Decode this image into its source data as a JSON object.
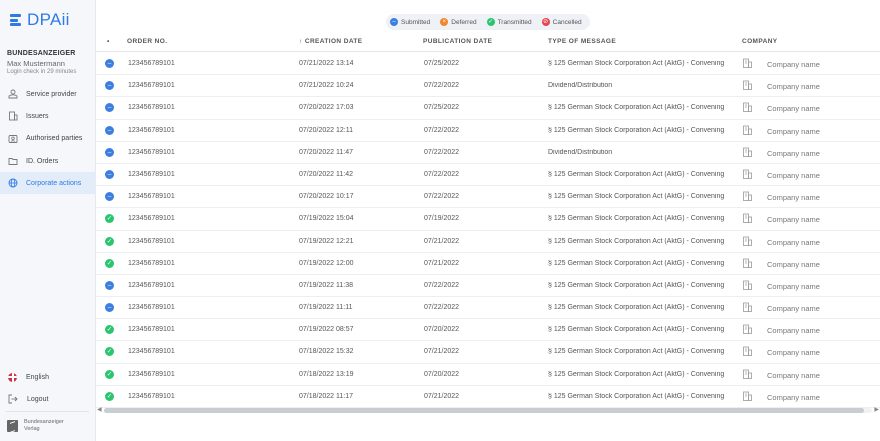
{
  "brand": {
    "logo_text": "DPAii",
    "accent": "#2d7be5"
  },
  "account": {
    "org_name": "BUNDESANZEIGER",
    "user_name": "Max Mustermann",
    "login_note": "Login check in 29 minutes"
  },
  "nav": {
    "items": [
      {
        "label": "Service provider",
        "icon": "service-icon"
      },
      {
        "label": "Issuers",
        "icon": "building-icon"
      },
      {
        "label": "Authorised parties",
        "icon": "party-icon"
      },
      {
        "label": "ID. Orders",
        "icon": "folder-icon"
      },
      {
        "label": "Corporate actions",
        "icon": "globe-icon",
        "active": true
      }
    ]
  },
  "footer": {
    "language": "English",
    "logout": "Logout",
    "brand_line1": "Bundesanzeiger",
    "brand_line2": "Verlag"
  },
  "legend": {
    "submitted": "Submitted",
    "deferred": "Deferred",
    "transmitted": "Transmitted",
    "cancelled": "Cancelled",
    "colors": {
      "submitted": "#3d7fe0",
      "deferred": "#f0872c",
      "transmitted": "#2bc56f",
      "cancelled": "#e6434f"
    }
  },
  "table": {
    "headers": {
      "sort": "•",
      "order_no": "ORDER NO.",
      "creation_date": "↑ CREATION DATE",
      "publication_date": "PUBLICATION DATE",
      "type": "TYPE OF MESSAGE",
      "company": "COMPANY"
    },
    "rows": [
      {
        "status": "submitted",
        "order_no": "123456789101",
        "created": "07/21/2022 13:14",
        "published": "07/25/2022",
        "type": "§ 125 German Stock Corporation Act (AktG) - Convening",
        "company": "Company name"
      },
      {
        "status": "submitted",
        "order_no": "123456789101",
        "created": "07/21/2022 10:24",
        "published": "07/22/2022",
        "type": "Dividend/Distribution",
        "company": "Company name"
      },
      {
        "status": "submitted",
        "order_no": "123456789101",
        "created": "07/20/2022 17:03",
        "published": "07/25/2022",
        "type": "§ 125 German Stock Corporation Act (AktG) - Convening",
        "company": "Company name"
      },
      {
        "status": "submitted",
        "order_no": "123456789101",
        "created": "07/20/2022 12:11",
        "published": "07/22/2022",
        "type": "§ 125 German Stock Corporation Act (AktG) - Convening",
        "company": "Company name"
      },
      {
        "status": "submitted",
        "order_no": "123456789101",
        "created": "07/20/2022 11:47",
        "published": "07/22/2022",
        "type": "Dividend/Distribution",
        "company": "Company name"
      },
      {
        "status": "submitted",
        "order_no": "123456789101",
        "created": "07/20/2022 11:42",
        "published": "07/22/2022",
        "type": "§ 125 German Stock Corporation Act (AktG) - Convening",
        "company": "Company name"
      },
      {
        "status": "submitted",
        "order_no": "123456789101",
        "created": "07/20/2022 10:17",
        "published": "07/22/2022",
        "type": "§ 125 German Stock Corporation Act (AktG) - Convening",
        "company": "Company name"
      },
      {
        "status": "transmitted",
        "order_no": "123456789101",
        "created": "07/19/2022 15:04",
        "published": "07/19/2022",
        "type": "§ 125 German Stock Corporation Act (AktG) - Convening",
        "company": "Company name"
      },
      {
        "status": "transmitted",
        "order_no": "123456789101",
        "created": "07/19/2022 12:21",
        "published": "07/21/2022",
        "type": "§ 125 German Stock Corporation Act (AktG) - Convening",
        "company": "Company name"
      },
      {
        "status": "transmitted",
        "order_no": "123456789101",
        "created": "07/19/2022 12:00",
        "published": "07/21/2022",
        "type": "§ 125 German Stock Corporation Act (AktG) - Convening",
        "company": "Company name"
      },
      {
        "status": "submitted",
        "order_no": "123456789101",
        "created": "07/19/2022 11:38",
        "published": "07/22/2022",
        "type": "§ 125 German Stock Corporation Act (AktG) - Convening",
        "company": "Company name"
      },
      {
        "status": "submitted",
        "order_no": "123456789101",
        "created": "07/19/2022 11:11",
        "published": "07/22/2022",
        "type": "§ 125 German Stock Corporation Act (AktG) - Convening",
        "company": "Company name"
      },
      {
        "status": "transmitted",
        "order_no": "123456789101",
        "created": "07/19/2022 08:57",
        "published": "07/20/2022",
        "type": "§ 125 German Stock Corporation Act (AktG) - Convening",
        "company": "Company name"
      },
      {
        "status": "transmitted",
        "order_no": "123456789101",
        "created": "07/18/2022 15:32",
        "published": "07/21/2022",
        "type": "§ 125 German Stock Corporation Act (AktG) - Convening",
        "company": "Company name"
      },
      {
        "status": "transmitted",
        "order_no": "123456789101",
        "created": "07/18/2022 13:19",
        "published": "07/20/2022",
        "type": "§ 125 German Stock Corporation Act (AktG) - Convening",
        "company": "Company name"
      },
      {
        "status": "transmitted",
        "order_no": "123456789101",
        "created": "07/18/2022 11:17",
        "published": "07/21/2022",
        "type": "§ 125 German Stock Corporation Act (AktG) - Convening",
        "company": "Company name"
      }
    ]
  }
}
